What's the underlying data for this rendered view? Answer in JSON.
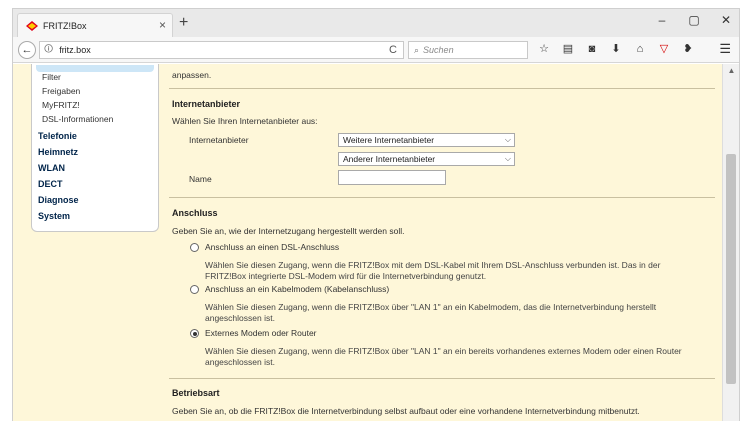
{
  "browser": {
    "tab_title": "FRITZ!Box",
    "tab_close": "×",
    "new_tab": "+",
    "controls": {
      "minimize": "–",
      "maximize": "▢",
      "close": "✕"
    },
    "url": "fritz.box",
    "search_placeholder": "Suchen",
    "back": "←",
    "reload": "C",
    "menu": "☰"
  },
  "sidebar": {
    "sub_items": [
      "Filter",
      "Freigaben",
      "MyFRITZ!",
      "DSL-Informationen"
    ],
    "main_items": [
      "Telefonie",
      "Heimnetz",
      "WLAN",
      "DECT",
      "Diagnose",
      "System"
    ]
  },
  "main": {
    "intro_text": "anpassen.",
    "provider": {
      "title": "Internetanbieter",
      "instruction": "Wählen Sie Ihren Internetanbieter aus:",
      "provider_label": "Internetanbieter",
      "provider_select": "Weitere Internetanbieter",
      "provider_select2": "Anderer Internetanbieter",
      "name_label": "Name",
      "name_value": ""
    },
    "connection": {
      "title": "Anschluss",
      "instruction": "Geben Sie an, wie der Internetzugang hergestellt werden soll.",
      "options": [
        {
          "label": "Anschluss an einen DSL-Anschluss",
          "desc": "Wählen Sie diesen Zugang, wenn die FRITZ!Box mit dem DSL-Kabel mit Ihrem DSL-Anschluss verbunden ist. Das in der FRITZ!Box integrierte DSL-Modem wird für die Internetverbindung genutzt.",
          "checked": false
        },
        {
          "label": "Anschluss an ein Kabelmodem (Kabelanschluss)",
          "desc": "Wählen Sie diesen Zugang, wenn die FRITZ!Box über \"LAN 1\" an ein Kabelmodem, das die Internetverbindung herstellt angeschlossen ist.",
          "checked": false
        },
        {
          "label": "Externes Modem oder Router",
          "desc": "Wählen Sie diesen Zugang, wenn die FRITZ!Box über \"LAN 1\" an ein bereits vorhandenes externes Modem oder einen Router angeschlossen ist.",
          "checked": true
        }
      ]
    },
    "operation": {
      "title": "Betriebsart",
      "instruction": "Geben Sie an, ob die FRITZ!Box die Internetverbindung selbst aufbaut oder eine vorhandene Internetverbindung mitbenutzt."
    }
  }
}
